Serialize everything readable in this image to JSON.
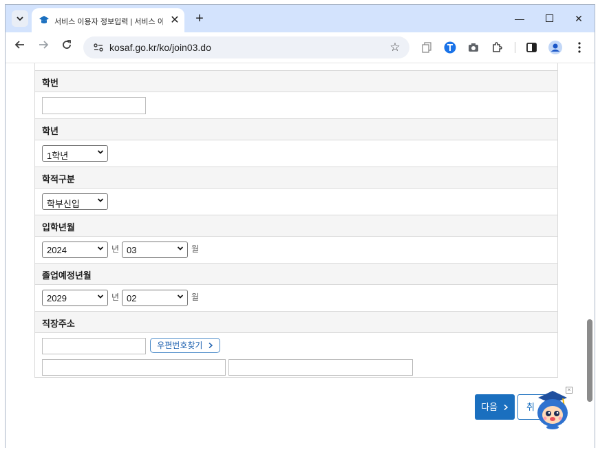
{
  "browser": {
    "tab_title": "서비스 이용자 정보입력 | 서비스 이용",
    "url": "kosaf.go.kr/ko/join03.do"
  },
  "form": {
    "student_id": {
      "label": "학번",
      "value": ""
    },
    "grade": {
      "label": "학년",
      "selected": "1학년"
    },
    "academic_status": {
      "label": "학적구분",
      "selected": "학부신입"
    },
    "admission": {
      "label": "입학년월",
      "year": "2024",
      "month": "03",
      "year_unit": "년",
      "month_unit": "월"
    },
    "graduation": {
      "label": "졸업예정년월",
      "year": "2029",
      "month": "02",
      "year_unit": "년",
      "month_unit": "월"
    },
    "work_address": {
      "label": "직장주소",
      "zip_button": "우편번호찾기",
      "zip_value": "",
      "addr1": "",
      "addr2": ""
    }
  },
  "actions": {
    "next": "다음",
    "cancel": "취"
  },
  "colors": {
    "primary": "#1a6fbf",
    "tab_strip": "#d3e3fd",
    "header_bg": "#f5f5f5"
  }
}
